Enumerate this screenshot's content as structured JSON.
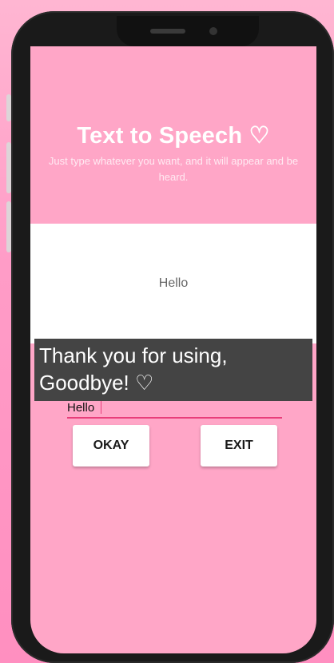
{
  "app": {
    "title": "Text to Speech ♡",
    "subtitle": "Just type whatever you want, and it will appear and be heard."
  },
  "output": {
    "text": "Hello"
  },
  "input": {
    "value": "Hello"
  },
  "buttons": {
    "okay_label": "OKAY",
    "exit_label": "EXIT"
  },
  "toast": {
    "message": "Thank you for using, Goodbye! ♡"
  },
  "colors": {
    "background": "#ffa6c7",
    "accent": "#e83e7a",
    "toast": "#444444"
  }
}
